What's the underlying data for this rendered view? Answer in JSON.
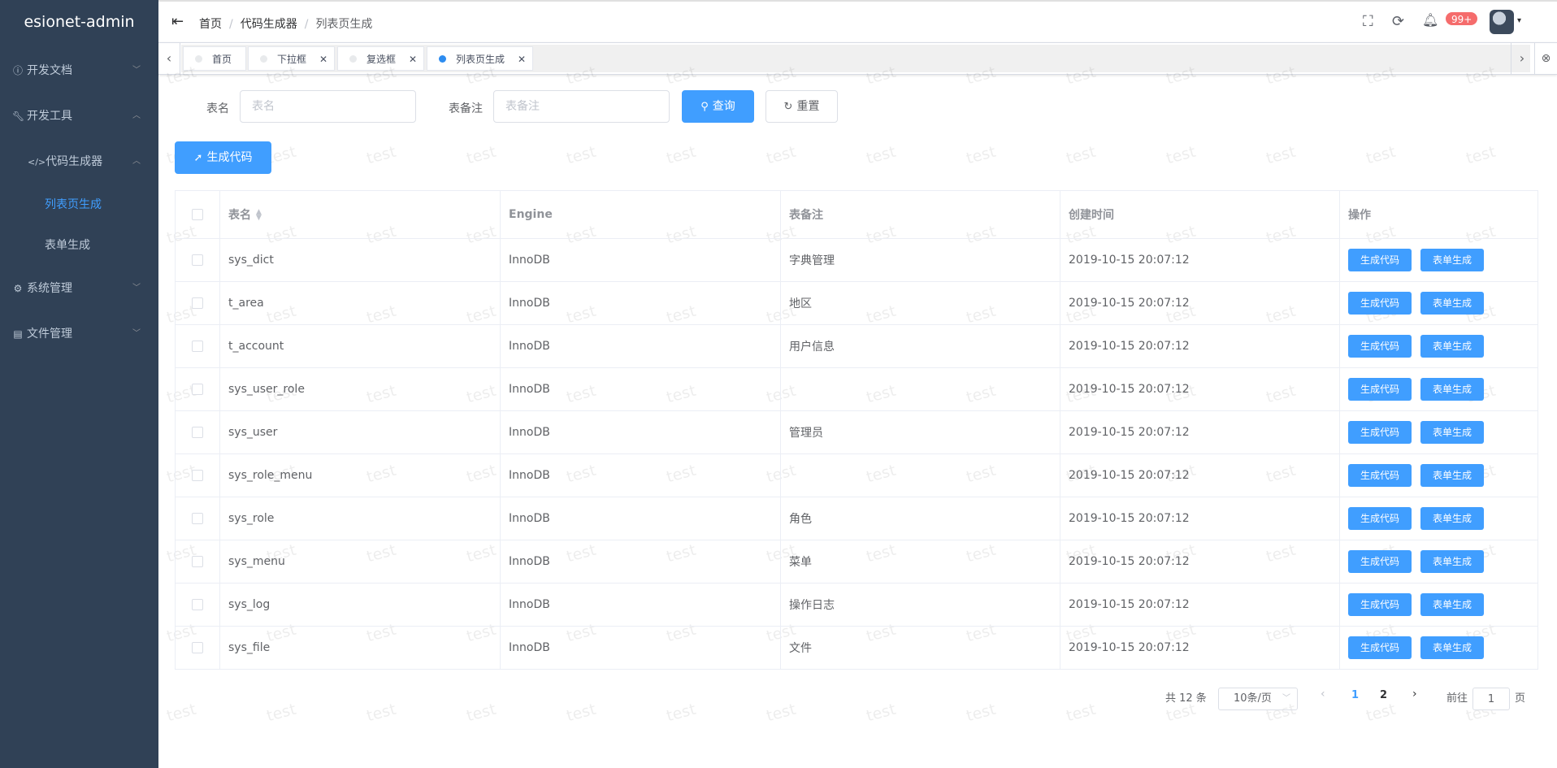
{
  "app": {
    "title": "esionet-admin"
  },
  "sidebar": {
    "items": [
      {
        "label": "开发文档"
      },
      {
        "label": "开发工具"
      },
      {
        "label": "代码生成器"
      },
      {
        "label": "列表页生成"
      },
      {
        "label": "表单生成"
      },
      {
        "label": "系统管理"
      },
      {
        "label": "文件管理"
      }
    ]
  },
  "header": {
    "breadcrumb": [
      "首页",
      "代码生成器",
      "列表页生成"
    ],
    "badge": "99+"
  },
  "tags": [
    {
      "label": "首页"
    },
    {
      "label": "下拉框"
    },
    {
      "label": "复选框"
    },
    {
      "label": "列表页生成"
    }
  ],
  "search": {
    "table_name_label": "表名",
    "table_name_placeholder": "表名",
    "table_comment_label": "表备注",
    "table_comment_placeholder": "表备注",
    "query_label": "查询",
    "reset_label": "重置"
  },
  "toolbar": {
    "generate_label": "生成代码"
  },
  "watermark": "test",
  "table": {
    "columns": [
      "表名",
      "Engine",
      "表备注",
      "创建时间",
      "操作"
    ],
    "rows": [
      {
        "name": "sys_dict",
        "engine": "InnoDB",
        "comment": "字典管理",
        "created": "2019-10-15 20:07:12"
      },
      {
        "name": "t_area",
        "engine": "InnoDB",
        "comment": "地区",
        "created": "2019-10-15 20:07:12"
      },
      {
        "name": "t_account",
        "engine": "InnoDB",
        "comment": "用户信息",
        "created": "2019-10-15 20:07:12"
      },
      {
        "name": "sys_user_role",
        "engine": "InnoDB",
        "comment": "",
        "created": "2019-10-15 20:07:12"
      },
      {
        "name": "sys_user",
        "engine": "InnoDB",
        "comment": "管理员",
        "created": "2019-10-15 20:07:12"
      },
      {
        "name": "sys_role_menu",
        "engine": "InnoDB",
        "comment": "",
        "created": "2019-10-15 20:07:12"
      },
      {
        "name": "sys_role",
        "engine": "InnoDB",
        "comment": "角色",
        "created": "2019-10-15 20:07:12"
      },
      {
        "name": "sys_menu",
        "engine": "InnoDB",
        "comment": "菜单",
        "created": "2019-10-15 20:07:12"
      },
      {
        "name": "sys_log",
        "engine": "InnoDB",
        "comment": "操作日志",
        "created": "2019-10-15 20:07:12"
      },
      {
        "name": "sys_file",
        "engine": "InnoDB",
        "comment": "文件",
        "created": "2019-10-15 20:07:12"
      }
    ],
    "row_actions": {
      "generate_label": "生成代码",
      "form_label": "表单生成"
    }
  },
  "pagination": {
    "total_text": "共 12 条",
    "page_size": "10条/页",
    "pages": [
      "1",
      "2"
    ],
    "current": "1",
    "goto_prefix": "前往",
    "goto_value": "1",
    "goto_suffix": "页"
  },
  "colors": {
    "sidebar_bg": "#304156",
    "primary": "#409eff",
    "active_text": "#409eff",
    "badge": "#f56c6c"
  }
}
